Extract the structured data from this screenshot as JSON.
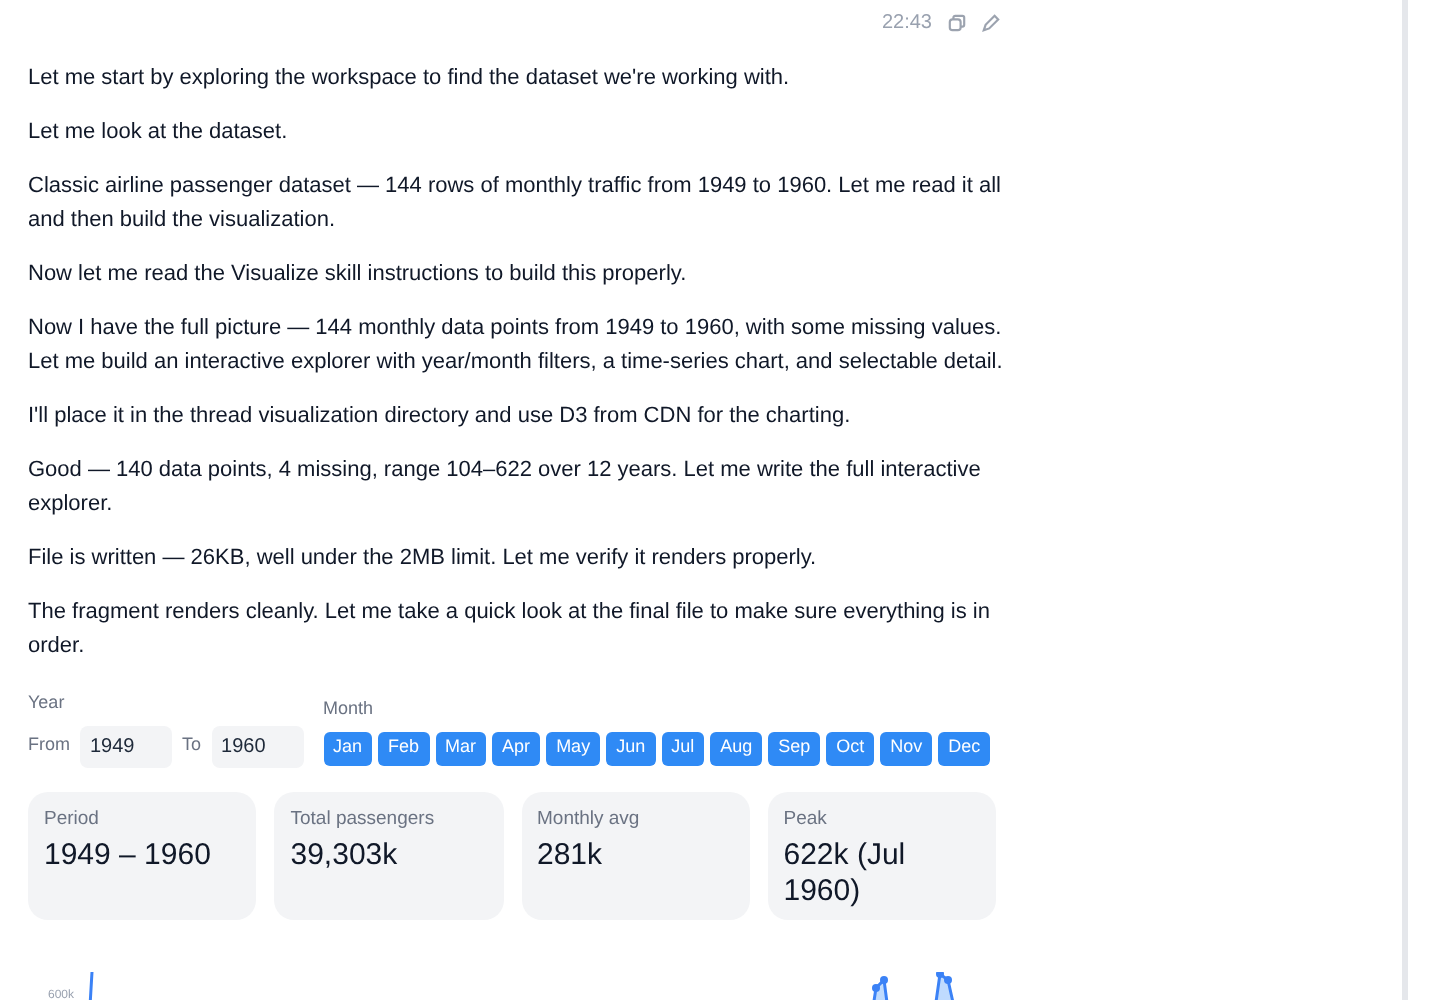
{
  "message_meta": {
    "time": "22:43"
  },
  "paragraphs": [
    "Let me start by exploring the workspace to find the dataset we're working with.",
    "Let me look at the dataset.",
    "Classic airline passenger dataset — 144 rows of monthly traffic from 1949 to 1960. Let me read it all and then build the visualization.",
    "Now let me read the Visualize skill instructions to build this properly.",
    "Now I have the full picture — 144 monthly data points from 1949 to 1960, with some missing values. Let me build an interactive explorer with year/month filters, a time-series chart, and selectable detail.",
    "I'll place it in the thread visualization directory and use D3 from CDN for the charting.",
    "Good — 140 data points, 4 missing, range 104–622 over 12 years. Let me write the full interactive explorer.",
    "File is written — 26KB, well under the 2MB limit. Let me verify it renders properly.",
    "The fragment renders cleanly. Let me take a quick look at the final file to make sure everything is in order."
  ],
  "filters": {
    "year_label": "Year",
    "from_label": "From",
    "from_value": "1949",
    "to_label": "To",
    "to_value": "1960",
    "month_label": "Month",
    "months": [
      {
        "label": "Jan",
        "selected": true
      },
      {
        "label": "Feb",
        "selected": true
      },
      {
        "label": "Mar",
        "selected": true
      },
      {
        "label": "Apr",
        "selected": true
      },
      {
        "label": "May",
        "selected": true
      },
      {
        "label": "Jun",
        "selected": true
      },
      {
        "label": "Jul",
        "selected": true
      },
      {
        "label": "Aug",
        "selected": true
      },
      {
        "label": "Sep",
        "selected": true
      },
      {
        "label": "Oct",
        "selected": true
      },
      {
        "label": "Nov",
        "selected": true
      },
      {
        "label": "Dec",
        "selected": true
      }
    ]
  },
  "stats": [
    {
      "label": "Period",
      "value": "1949 – 1960"
    },
    {
      "label": "Total passengers",
      "value": "39,303k"
    },
    {
      "label": "Monthly avg",
      "value": "281k"
    },
    {
      "label": "Peak",
      "value": "622k (Jul 1960)"
    }
  ],
  "chart": {
    "tick_label": "600k"
  }
}
